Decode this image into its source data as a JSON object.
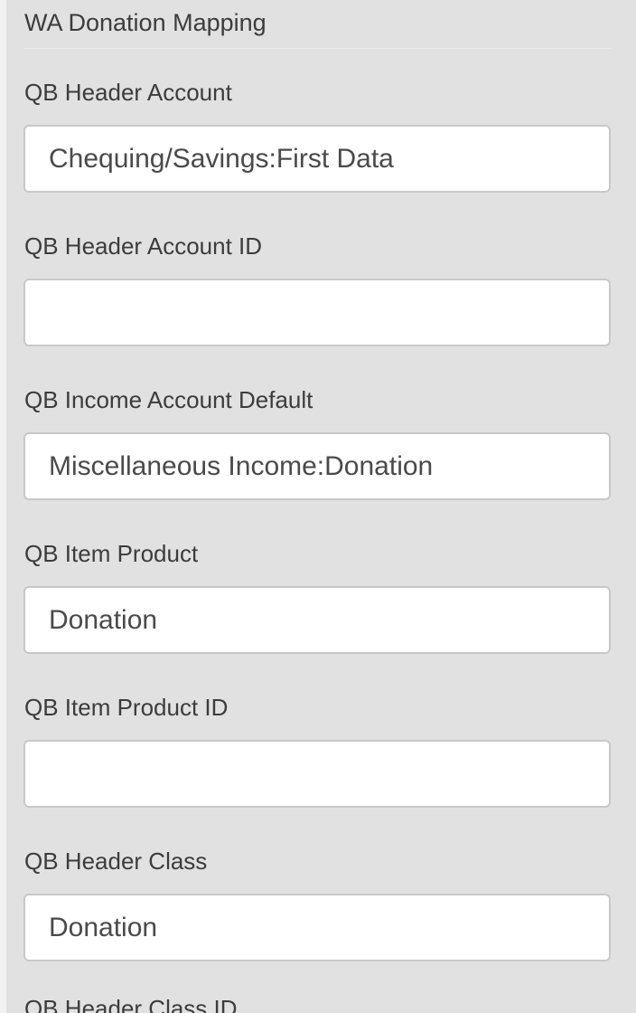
{
  "section": {
    "title": "WA Donation Mapping"
  },
  "fields": [
    {
      "label": "QB Header Account",
      "value": "Chequing/Savings:First Data",
      "placeholder": ""
    },
    {
      "label": "QB Header Account ID",
      "value": "",
      "placeholder": ""
    },
    {
      "label": "QB Income Account Default",
      "value": "Miscellaneous Income:Donation",
      "placeholder": ""
    },
    {
      "label": "QB Item Product",
      "value": "Donation",
      "placeholder": ""
    },
    {
      "label": "QB Item Product ID",
      "value": "",
      "placeholder": ""
    },
    {
      "label": "QB Header Class",
      "value": "Donation",
      "placeholder": ""
    },
    {
      "label": "QB Header Class ID"
    }
  ]
}
